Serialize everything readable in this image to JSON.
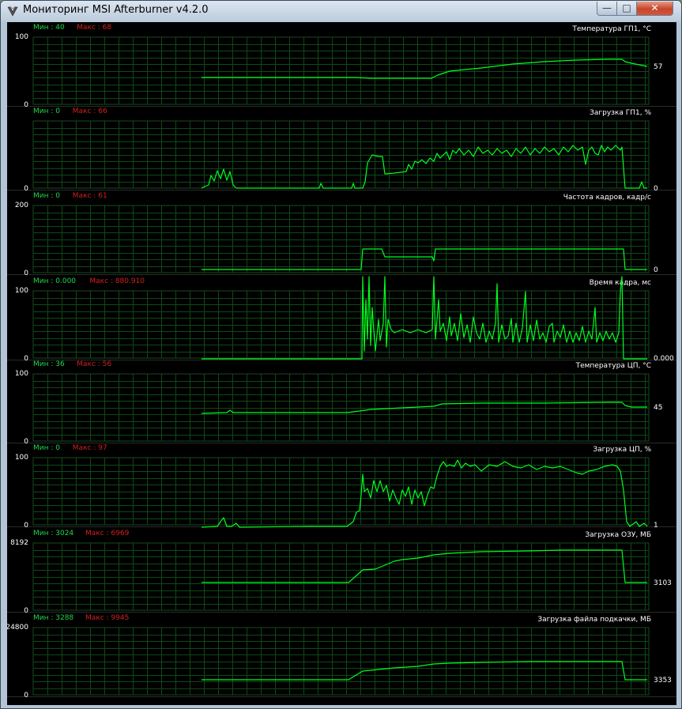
{
  "window": {
    "title": "Мониторинг MSI Afterburner v4.2.0",
    "buttons": {
      "minimize_icon": "minimize-icon",
      "maximize_icon": "maximize-icon",
      "close_icon": "close-icon"
    }
  },
  "colors": {
    "line": "#00ff1e",
    "grid": "#0d4a17",
    "min_label": "#1fd84a",
    "max_label": "#d2201c",
    "background": "#000000"
  },
  "graphs": [
    {
      "id": "gpu-temp",
      "min_text": "Мин : 40",
      "max_text": "Макс : 68",
      "title": "Температура ГП1, °С",
      "ymax": "100",
      "ymin": "0",
      "current": "57"
    },
    {
      "id": "gpu-load",
      "min_text": "Мин : 0",
      "max_text": "Макс : 66",
      "title": "Загрузка ГП1, %",
      "ymax": "",
      "ymin": "0",
      "current": "0"
    },
    {
      "id": "framerate",
      "min_text": "Мин : 0",
      "max_text": "Макс : 61",
      "title": "Частота кадров, кадр/с",
      "ymax": "200",
      "ymin": "0",
      "current": "0"
    },
    {
      "id": "frametime",
      "min_text": "Мин : 0.000",
      "max_text": "Макс : 880.910",
      "title": "Время кадра, мс",
      "ymax": "100",
      "ymin": "0",
      "current": "0.000"
    },
    {
      "id": "cpu-temp",
      "min_text": "Мин : 36",
      "max_text": "Макс : 56",
      "title": "Температура ЦП, °С",
      "ymax": "100",
      "ymin": "0",
      "current": "45"
    },
    {
      "id": "cpu-load",
      "min_text": "Мин : 0",
      "max_text": "Макс : 97",
      "title": "Загрузка ЦП, %",
      "ymax": "100",
      "ymin": "0",
      "current": "1"
    },
    {
      "id": "ram",
      "min_text": "Мин : 3024",
      "max_text": "Макс : 6969",
      "title": "Загрузка ОЗУ, МБ",
      "ymax": "8192",
      "ymin": "0",
      "current": "3103"
    },
    {
      "id": "pagefile",
      "min_text": "Мин : 3288",
      "max_text": "Макс : 9945",
      "title": "Загрузка файла подкачки, МБ",
      "ymax": "24800",
      "ymin": "0",
      "current": "3353"
    }
  ]
}
